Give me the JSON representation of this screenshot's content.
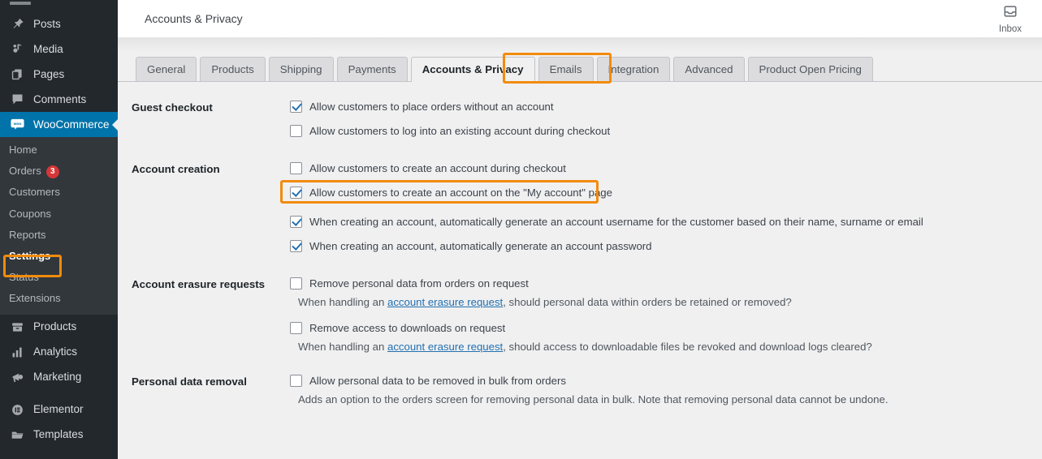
{
  "sidebar": {
    "items": [
      {
        "label": "Posts",
        "icon": "pin-icon",
        "name": "sidebar-item-posts"
      },
      {
        "label": "Media",
        "icon": "media-icon",
        "name": "sidebar-item-media"
      },
      {
        "label": "Pages",
        "icon": "pages-icon",
        "name": "sidebar-item-pages"
      },
      {
        "label": "Comments",
        "icon": "comment-icon",
        "name": "sidebar-item-comments"
      }
    ],
    "current": {
      "label": "WooCommerce",
      "icon": "woocommerce-icon",
      "name": "sidebar-item-woocommerce"
    },
    "submenu": [
      {
        "label": "Home",
        "badge": "",
        "name": "sidebar-subitem-home",
        "bold": false
      },
      {
        "label": "Orders",
        "badge": "3",
        "name": "sidebar-subitem-orders",
        "bold": false
      },
      {
        "label": "Customers",
        "badge": "",
        "name": "sidebar-subitem-customers",
        "bold": false
      },
      {
        "label": "Coupons",
        "badge": "",
        "name": "sidebar-subitem-coupons",
        "bold": false
      },
      {
        "label": "Reports",
        "badge": "",
        "name": "sidebar-subitem-reports",
        "bold": false
      },
      {
        "label": "Settings",
        "badge": "",
        "name": "sidebar-subitem-settings",
        "bold": true
      },
      {
        "label": "Status",
        "badge": "",
        "name": "sidebar-subitem-status",
        "bold": false
      },
      {
        "label": "Extensions",
        "badge": "",
        "name": "sidebar-subitem-extensions",
        "bold": false
      }
    ],
    "items_bottom": [
      {
        "label": "Products",
        "icon": "products-icon",
        "name": "sidebar-item-products"
      },
      {
        "label": "Analytics",
        "icon": "analytics-icon",
        "name": "sidebar-item-analytics"
      },
      {
        "label": "Marketing",
        "icon": "megaphone-icon",
        "name": "sidebar-item-marketing"
      }
    ],
    "items_bottom2": [
      {
        "label": "Elementor",
        "icon": "elementor-icon",
        "name": "sidebar-item-elementor"
      },
      {
        "label": "Templates",
        "icon": "folder-icon",
        "name": "sidebar-item-templates"
      }
    ]
  },
  "topbar": {
    "page_title": "Accounts & Privacy",
    "inbox_label": "Inbox"
  },
  "tabs": [
    {
      "label": "General",
      "active": false
    },
    {
      "label": "Products",
      "active": false
    },
    {
      "label": "Shipping",
      "active": false
    },
    {
      "label": "Payments",
      "active": false
    },
    {
      "label": "Accounts & Privacy",
      "active": true
    },
    {
      "label": "Emails",
      "active": false
    },
    {
      "label": "Integration",
      "active": false
    },
    {
      "label": "Advanced",
      "active": false
    },
    {
      "label": "Product Open Pricing",
      "active": false
    }
  ],
  "sections": {
    "guest_checkout": {
      "label": "Guest checkout",
      "row1": "Allow customers to place orders without an account",
      "row2": "Allow customers to log into an existing account during checkout"
    },
    "account_creation": {
      "label": "Account creation",
      "row1": "Allow customers to create an account during checkout",
      "row2": "Allow customers to create an account on the \"My account\" page",
      "row3": "When creating an account, automatically generate an account username for the customer based on their name, surname or email",
      "row4": "When creating an account, automatically generate an account password"
    },
    "account_erasure": {
      "label": "Account erasure requests",
      "row1": "Remove personal data from orders on request",
      "desc1_pre": "When handling an ",
      "desc1_link": "account erasure request",
      "desc1_post": ", should personal data within orders be retained or removed?",
      "row2": "Remove access to downloads on request",
      "desc2_pre": "When handling an ",
      "desc2_link": "account erasure request",
      "desc2_post": ", should access to downloadable files be revoked and download logs cleared?"
    },
    "personal_data_removal": {
      "label": "Personal data removal",
      "row1": "Allow personal data to be removed in bulk from orders",
      "desc1": "Adds an option to the orders screen for removing personal data in bulk. Note that removing personal data cannot be undone."
    }
  },
  "colors": {
    "highlight": "#f28b0c",
    "sidebar_bg": "#23282d",
    "submenu_bg": "#32373c",
    "current_bg": "#0073aa",
    "badge_bg": "#d63638",
    "link": "#2271b1",
    "content_bg": "#f0f0f1"
  }
}
